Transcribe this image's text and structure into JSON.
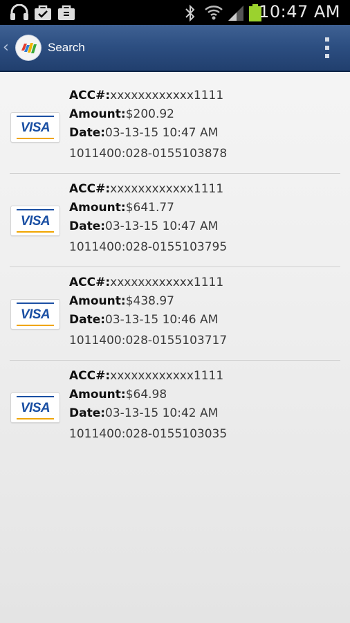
{
  "status_bar": {
    "time": "10:47 AM",
    "icons": [
      "headphones-icon",
      "shopping-bag-icon",
      "briefcase-icon",
      "bluetooth-icon",
      "wifi-icon",
      "signal-icon",
      "battery-icon"
    ]
  },
  "action_bar": {
    "title": "Search",
    "back_icon": "chevron-left-icon",
    "menu_icon": "overflow-menu-icon"
  },
  "transactions": [
    {
      "card": "VISA",
      "acc_label": "ACC#:",
      "acc": "xxxxxxxxxxxx1111",
      "amount_label": "Amount:",
      "amount": "$200.92",
      "date_label": "Date:",
      "date": "03-13-15 10:47 AM",
      "ref": "1011400:028-0155103878"
    },
    {
      "card": "VISA",
      "acc_label": "ACC#:",
      "acc": "xxxxxxxxxxxx1111",
      "amount_label": "Amount:",
      "amount": "$641.77",
      "date_label": "Date:",
      "date": "03-13-15 10:47 AM",
      "ref": "1011400:028-0155103795"
    },
    {
      "card": "VISA",
      "acc_label": "ACC#:",
      "acc": "xxxxxxxxxxxx1111",
      "amount_label": "Amount:",
      "amount": "$438.97",
      "date_label": "Date:",
      "date": "03-13-15 10:46 AM",
      "ref": "1011400:028-0155103717"
    },
    {
      "card": "VISA",
      "acc_label": "ACC#:",
      "acc": "xxxxxxxxxxxx1111",
      "amount_label": "Amount:",
      "amount": "$64.98",
      "date_label": "Date:",
      "date": "03-13-15 10:42 AM",
      "ref": "1011400:028-0155103035"
    }
  ],
  "colors": {
    "action_bar": "#2d4f82",
    "visa_blue": "#1a4fa3",
    "visa_gold": "#f0a500",
    "battery": "#9bd22e"
  }
}
